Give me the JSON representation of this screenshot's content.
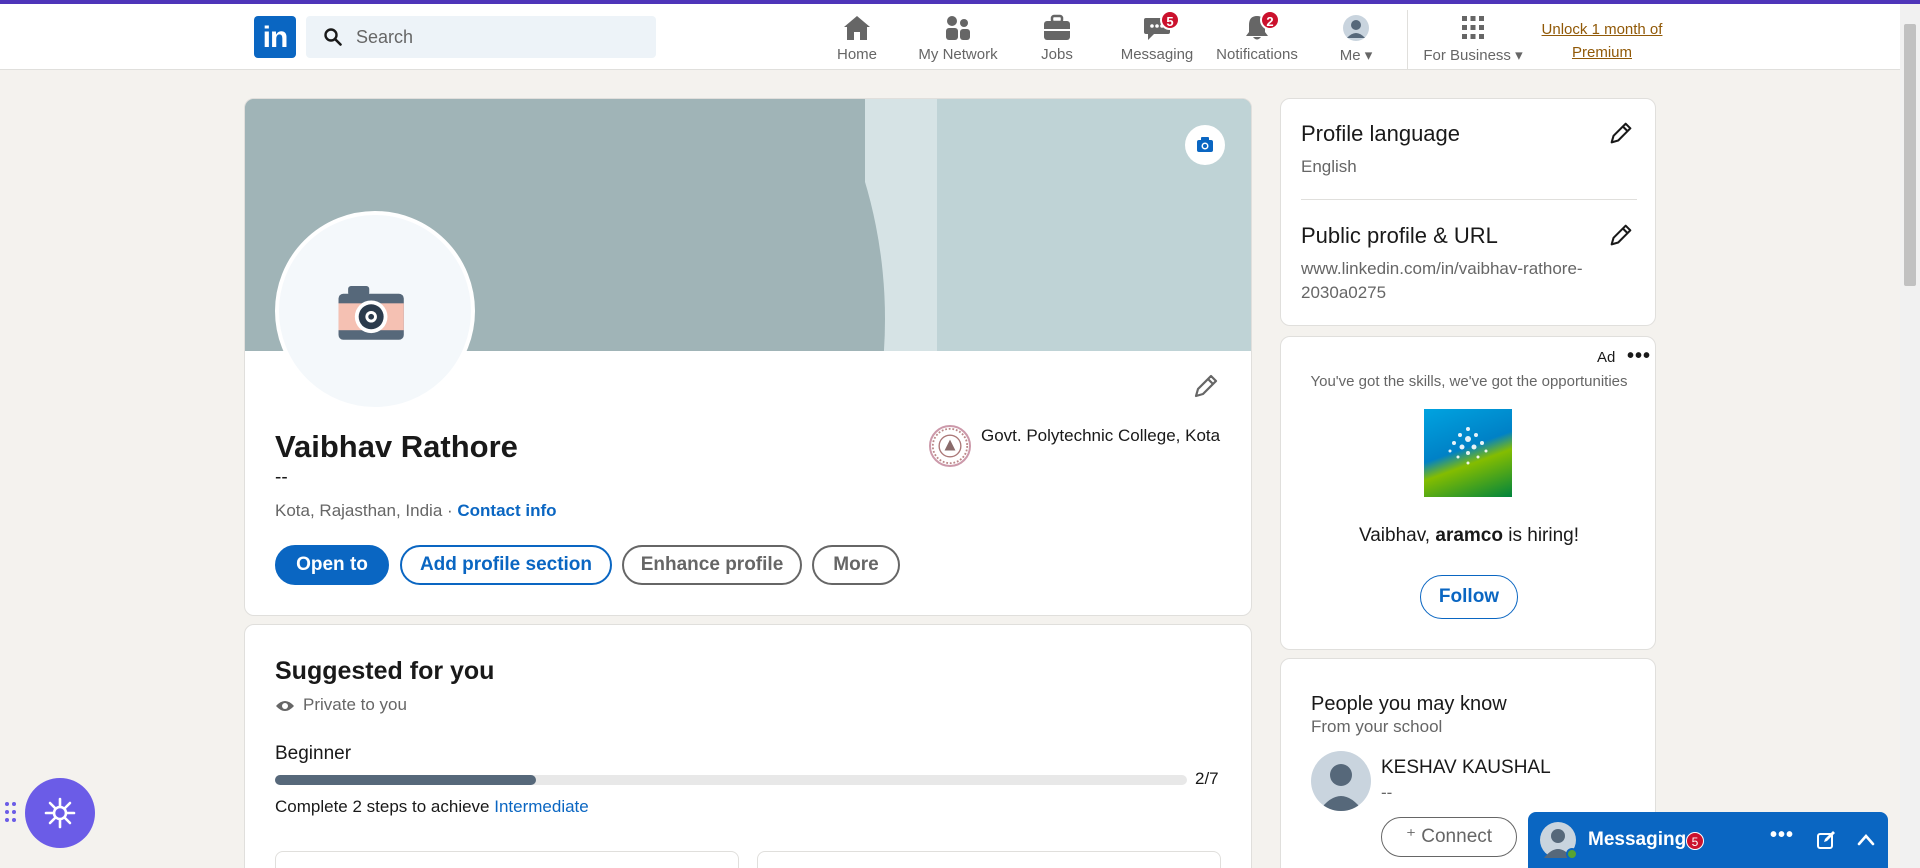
{
  "nav": {
    "logo": "in",
    "search_placeholder": "Search",
    "items": [
      {
        "label": "Home",
        "icon": "home-icon"
      },
      {
        "label": "My Network",
        "icon": "network-icon"
      },
      {
        "label": "Jobs",
        "icon": "briefcase-icon"
      },
      {
        "label": "Messaging",
        "icon": "messaging-icon",
        "badge": "5"
      },
      {
        "label": "Notifications",
        "icon": "bell-icon",
        "badge": "2"
      },
      {
        "label": "Me",
        "icon": "avatar-icon"
      }
    ],
    "business": "For Business",
    "premium_line1": "Unlock 1 month of",
    "premium_line2": "Premium"
  },
  "profile": {
    "name": "Vaibhav Rathore",
    "headline": "--",
    "location": "Kota, Rajasthan, India · ",
    "contact_info": "Contact info",
    "school": "Govt. Polytechnic College, Kota",
    "buttons": {
      "open_to": "Open to",
      "add_section": "Add profile section",
      "enhance": "Enhance profile",
      "more": "More"
    }
  },
  "suggested": {
    "title": "Suggested for you",
    "privacy": "Private to you",
    "level": "Beginner",
    "progress": "2/7",
    "progress_fraction": 0.2857,
    "complete_text": "Complete 2 steps to achieve ",
    "complete_link": "Intermediate"
  },
  "sidebar": {
    "language_title": "Profile language",
    "language_value": "English",
    "url_title": "Public profile & URL",
    "url_value": "www.linkedin.com/in/vaibhav-rathore-2030a0275"
  },
  "ad": {
    "label": "Ad",
    "menu": "•••",
    "tagline": "You've got the skills, we've got the opportunities",
    "hiring_prefix": "Vaibhav, ",
    "company": "aramco",
    "hiring_suffix": " is hiring!",
    "follow": "Follow"
  },
  "people": {
    "title": "People you may know",
    "subtitle": "From your school",
    "person_name": "KESHAV KAUSHAL",
    "person_headline": "--",
    "connect": "Connect"
  },
  "messaging": {
    "label": "Messaging",
    "badge": "5",
    "menu": "•••"
  },
  "colors": {
    "brand": "#0a66c2",
    "badge": "#cb112d",
    "premium": "#915907"
  }
}
